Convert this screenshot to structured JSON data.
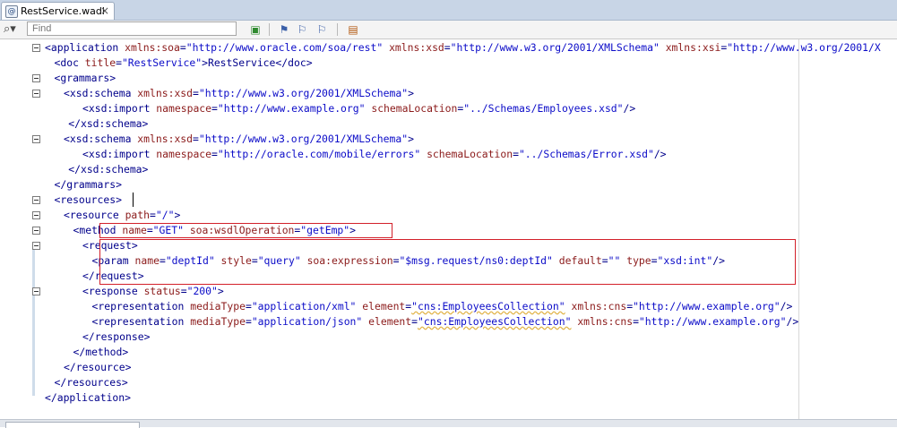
{
  "tab": {
    "label": "RestService.wadl",
    "close": "×",
    "icon": "@"
  },
  "find": {
    "placeholder": "Find",
    "icon": "search-icon"
  },
  "toolbar_buttons": [
    "find-next-icon",
    "bookmark-icon",
    "prev-bookmark-icon",
    "next-bookmark-icon",
    "editor-options-icon"
  ],
  "code_lines": [
    {
      "indent": 0,
      "fold": true,
      "tokens": [
        [
          "t",
          "<application "
        ],
        [
          "a",
          "xmlns:soa"
        ],
        [
          "t",
          "="
        ],
        [
          "v",
          "\"http://www.oracle.com/soa/rest\""
        ],
        [
          "t",
          " "
        ],
        [
          "a",
          "xmlns:xsd"
        ],
        [
          "t",
          "="
        ],
        [
          "v",
          "\"http://www.w3.org/2001/XMLSchema\""
        ],
        [
          "t",
          " "
        ],
        [
          "a",
          "xmlns:xsi"
        ],
        [
          "t",
          "="
        ],
        [
          "v",
          "\"http://www.w3.org/2001/X"
        ]
      ]
    },
    {
      "indent": 2,
      "fold": false,
      "tokens": [
        [
          "t",
          "<doc "
        ],
        [
          "a",
          "title"
        ],
        [
          "t",
          "="
        ],
        [
          "v",
          "\"RestService\""
        ],
        [
          "t",
          ">RestService</doc>"
        ]
      ]
    },
    {
      "indent": 2,
      "fold": true,
      "tokens": [
        [
          "t",
          "<grammars>"
        ]
      ]
    },
    {
      "indent": 4,
      "fold": true,
      "tokens": [
        [
          "t",
          "<xsd:schema "
        ],
        [
          "a",
          "xmlns:xsd"
        ],
        [
          "t",
          "="
        ],
        [
          "v",
          "\"http://www.w3.org/2001/XMLSchema\""
        ],
        [
          "t",
          ">"
        ]
      ]
    },
    {
      "indent": 8,
      "fold": false,
      "tokens": [
        [
          "t",
          "<xsd:import "
        ],
        [
          "a",
          "namespace"
        ],
        [
          "t",
          "="
        ],
        [
          "v",
          "\"http://www.example.org\""
        ],
        [
          "t",
          " "
        ],
        [
          "a",
          "schemaLocation"
        ],
        [
          "t",
          "="
        ],
        [
          "v",
          "\"../Schemas/Employees.xsd\""
        ],
        [
          "t",
          "/>"
        ]
      ]
    },
    {
      "indent": 5,
      "fold": false,
      "tokens": [
        [
          "t",
          "</xsd:schema>"
        ]
      ]
    },
    {
      "indent": 4,
      "fold": true,
      "tokens": [
        [
          "t",
          "<xsd:schema "
        ],
        [
          "a",
          "xmlns:xsd"
        ],
        [
          "t",
          "="
        ],
        [
          "v",
          "\"http://www.w3.org/2001/XMLSchema\""
        ],
        [
          "t",
          ">"
        ]
      ]
    },
    {
      "indent": 8,
      "fold": false,
      "tokens": [
        [
          "t",
          "<xsd:import "
        ],
        [
          "a",
          "namespace"
        ],
        [
          "t",
          "="
        ],
        [
          "v",
          "\"http://oracle.com/mobile/errors\""
        ],
        [
          "t",
          " "
        ],
        [
          "a",
          "schemaLocation"
        ],
        [
          "t",
          "="
        ],
        [
          "v",
          "\"../Schemas/Error.xsd\""
        ],
        [
          "t",
          "/>"
        ]
      ]
    },
    {
      "indent": 5,
      "fold": false,
      "tokens": [
        [
          "t",
          "</xsd:schema>"
        ]
      ]
    },
    {
      "indent": 2,
      "fold": false,
      "tokens": [
        [
          "t",
          "</grammars>"
        ]
      ]
    },
    {
      "indent": 2,
      "fold": true,
      "tokens": [
        [
          "t",
          "<resources>"
        ]
      ]
    },
    {
      "indent": 4,
      "fold": true,
      "tokens": [
        [
          "t",
          "<resource "
        ],
        [
          "a",
          "path"
        ],
        [
          "t",
          "="
        ],
        [
          "v",
          "\"/\""
        ],
        [
          "t",
          ">"
        ]
      ]
    },
    {
      "indent": 6,
      "fold": true,
      "tokens": [
        [
          "t",
          "<method "
        ],
        [
          "a",
          "name"
        ],
        [
          "t",
          "="
        ],
        [
          "v",
          "\"GET\""
        ],
        [
          "t",
          " "
        ],
        [
          "a",
          "soa:wsdlOperation"
        ],
        [
          "t",
          "="
        ],
        [
          "v",
          "\"getEmp\""
        ],
        [
          "t",
          ">"
        ]
      ]
    },
    {
      "indent": 8,
      "fold": true,
      "tokens": [
        [
          "t",
          "<request>"
        ]
      ]
    },
    {
      "indent": 10,
      "fold": false,
      "tokens": [
        [
          "t",
          "<param "
        ],
        [
          "a",
          "name"
        ],
        [
          "t",
          "="
        ],
        [
          "v",
          "\"deptId\""
        ],
        [
          "t",
          " "
        ],
        [
          "a",
          "style"
        ],
        [
          "t",
          "="
        ],
        [
          "v",
          "\"query\""
        ],
        [
          "t",
          " "
        ],
        [
          "a",
          "soa:expression"
        ],
        [
          "t",
          "="
        ],
        [
          "v",
          "\"$msg.request/ns0:deptId\""
        ],
        [
          "t",
          " "
        ],
        [
          "a",
          "default"
        ],
        [
          "t",
          "="
        ],
        [
          "v",
          "\"\""
        ],
        [
          "t",
          " "
        ],
        [
          "a",
          "type"
        ],
        [
          "t",
          "="
        ],
        [
          "v",
          "\"xsd:int\""
        ],
        [
          "t",
          "/>"
        ]
      ]
    },
    {
      "indent": 8,
      "fold": false,
      "tokens": [
        [
          "t",
          "</request>"
        ]
      ]
    },
    {
      "indent": 8,
      "fold": true,
      "tokens": [
        [
          "t",
          "<response "
        ],
        [
          "a",
          "status"
        ],
        [
          "t",
          "="
        ],
        [
          "v",
          "\"200\""
        ],
        [
          "t",
          ">"
        ]
      ]
    },
    {
      "indent": 10,
      "fold": false,
      "tokens": [
        [
          "t",
          "<representation "
        ],
        [
          "a",
          "mediaType"
        ],
        [
          "t",
          "="
        ],
        [
          "v",
          "\"application/xml\""
        ],
        [
          "t",
          " "
        ],
        [
          "a",
          "element"
        ],
        [
          "t",
          "="
        ],
        [
          "w",
          "\"cns:EmployeesCollection\""
        ],
        [
          "t",
          " "
        ],
        [
          "a",
          "xmlns:cns"
        ],
        [
          "t",
          "="
        ],
        [
          "v",
          "\"http://www.example.org\""
        ],
        [
          "t",
          "/>"
        ]
      ]
    },
    {
      "indent": 10,
      "fold": false,
      "tokens": [
        [
          "t",
          "<representation "
        ],
        [
          "a",
          "mediaType"
        ],
        [
          "t",
          "="
        ],
        [
          "v",
          "\"application/json\""
        ],
        [
          "t",
          " "
        ],
        [
          "a",
          "element"
        ],
        [
          "t",
          "="
        ],
        [
          "w",
          "\"cns:EmployeesCollection\""
        ],
        [
          "t",
          " "
        ],
        [
          "a",
          "xmlns:cns"
        ],
        [
          "t",
          "="
        ],
        [
          "v",
          "\"http://www.example.org\""
        ],
        [
          "t",
          "/>"
        ]
      ]
    },
    {
      "indent": 8,
      "fold": false,
      "tokens": [
        [
          "t",
          "</response>"
        ]
      ]
    },
    {
      "indent": 6,
      "fold": false,
      "tokens": [
        [
          "t",
          "</method>"
        ]
      ]
    },
    {
      "indent": 4,
      "fold": false,
      "tokens": [
        [
          "t",
          "</resource>"
        ]
      ]
    },
    {
      "indent": 2,
      "fold": false,
      "tokens": [
        [
          "t",
          "</resources>"
        ]
      ]
    },
    {
      "indent": 0,
      "fold": false,
      "tokens": [
        [
          "t",
          "</application>"
        ]
      ]
    }
  ],
  "colors": {
    "tag": "#00008b",
    "attr": "#8b1a1a",
    "value": "#0b0bc8",
    "highlight": "#d3202a"
  }
}
